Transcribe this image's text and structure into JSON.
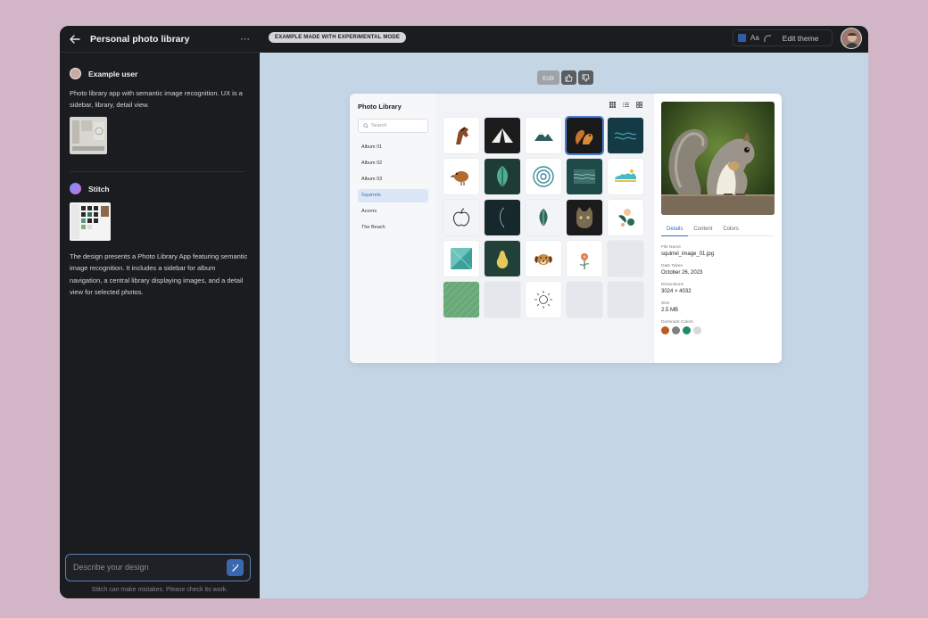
{
  "sidebar": {
    "title": "Personal photo library",
    "user_name": "Example user",
    "user_message": "Photo library app with semantic image recognition. UX is a sidebar, library, detail view.",
    "assistant_name": "Stitch",
    "assistant_message": "The design presents a Photo Library App featuring semantic image recognition. It includes a sidebar for album navigation, a central library displaying images, and a detail view for selected photos.",
    "input_placeholder": "Describe your design",
    "disclaimer": "Stitch can make mistakes. Please check its work."
  },
  "topbar": {
    "badge": "EXAMPLE MADE WITH EXPERIMENTAL MODE",
    "font_label": "Aa",
    "edit_theme": "Edit theme"
  },
  "feedback": {
    "edit": "Edit"
  },
  "design": {
    "title": "Photo Library",
    "search_placeholder": "Search",
    "albums": [
      "Album 01",
      "Album 02",
      "Album 03",
      "Squirrels",
      "Acorns",
      "The Beach"
    ],
    "active_album": "Squirrels",
    "tabs": [
      "Details",
      "Content",
      "Colors"
    ],
    "active_tab": "Details",
    "details": {
      "file_name_label": "File Name",
      "file_name": "squirrel_image_01.jpg",
      "date_label": "Date Taken",
      "date": "October 26, 2023",
      "dimensions_label": "Dimensions",
      "dimensions": "3024 × 4032",
      "size_label": "Size",
      "size": "2.5 MB",
      "colors_label": "Dominant Colors",
      "colors": [
        "#b85c1f",
        "#7d7f84",
        "#1f8a68",
        "#d7d8da"
      ]
    }
  },
  "colors": {
    "accent": "#3a68b0",
    "canvas": "#c4d6e6",
    "frame": "#d2b6c8"
  }
}
